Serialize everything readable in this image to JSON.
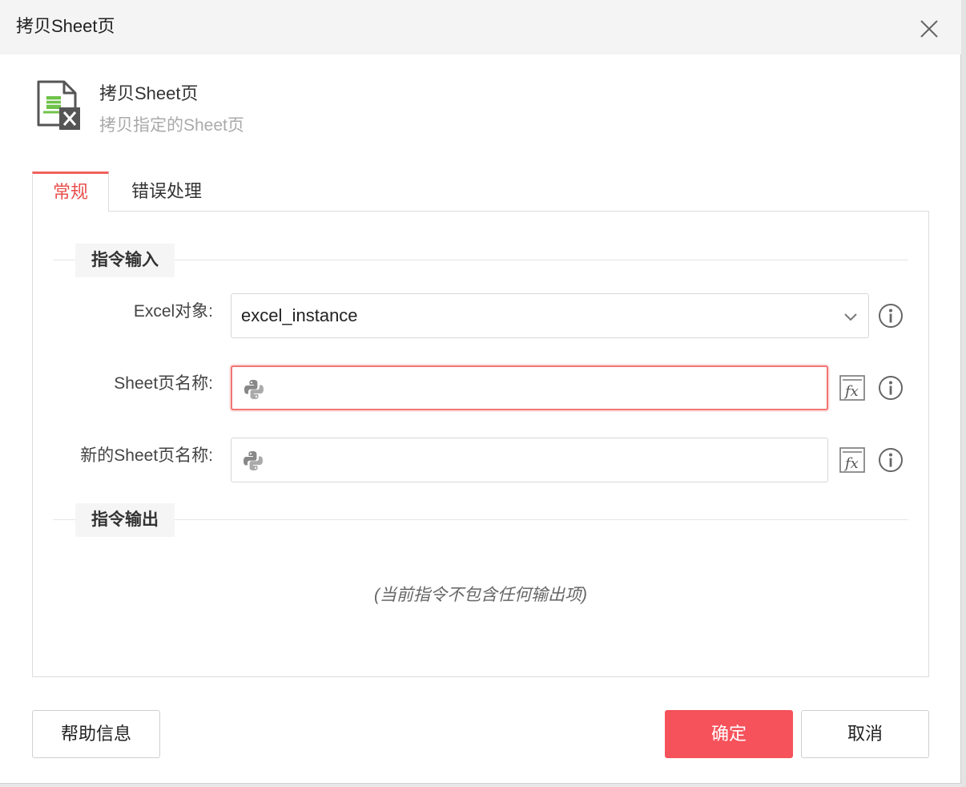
{
  "window": {
    "title": "拷贝Sheet页"
  },
  "header": {
    "name": "拷贝Sheet页",
    "description": "拷贝指定的Sheet页",
    "icon": "excel-sheet-icon"
  },
  "tabs": [
    {
      "label": "常规",
      "active": true
    },
    {
      "label": "错误处理",
      "active": false
    }
  ],
  "sections": {
    "input_title": "指令输入",
    "output_title": "指令输出",
    "output_empty": "(当前指令不包含任何输出项)"
  },
  "fields": {
    "excel_object": {
      "label": "Excel对象:",
      "value": "excel_instance"
    },
    "sheet_name": {
      "label": "Sheet页名称:",
      "value": "",
      "state": "error"
    },
    "new_sheet_name": {
      "label": "新的Sheet页名称:",
      "value": ""
    }
  },
  "buttons": {
    "help": "帮助信息",
    "ok": "确定",
    "cancel": "取消"
  },
  "colors": {
    "accent": "#f5525b",
    "tab_active": "#e8504e",
    "error_border": "#f07573"
  }
}
